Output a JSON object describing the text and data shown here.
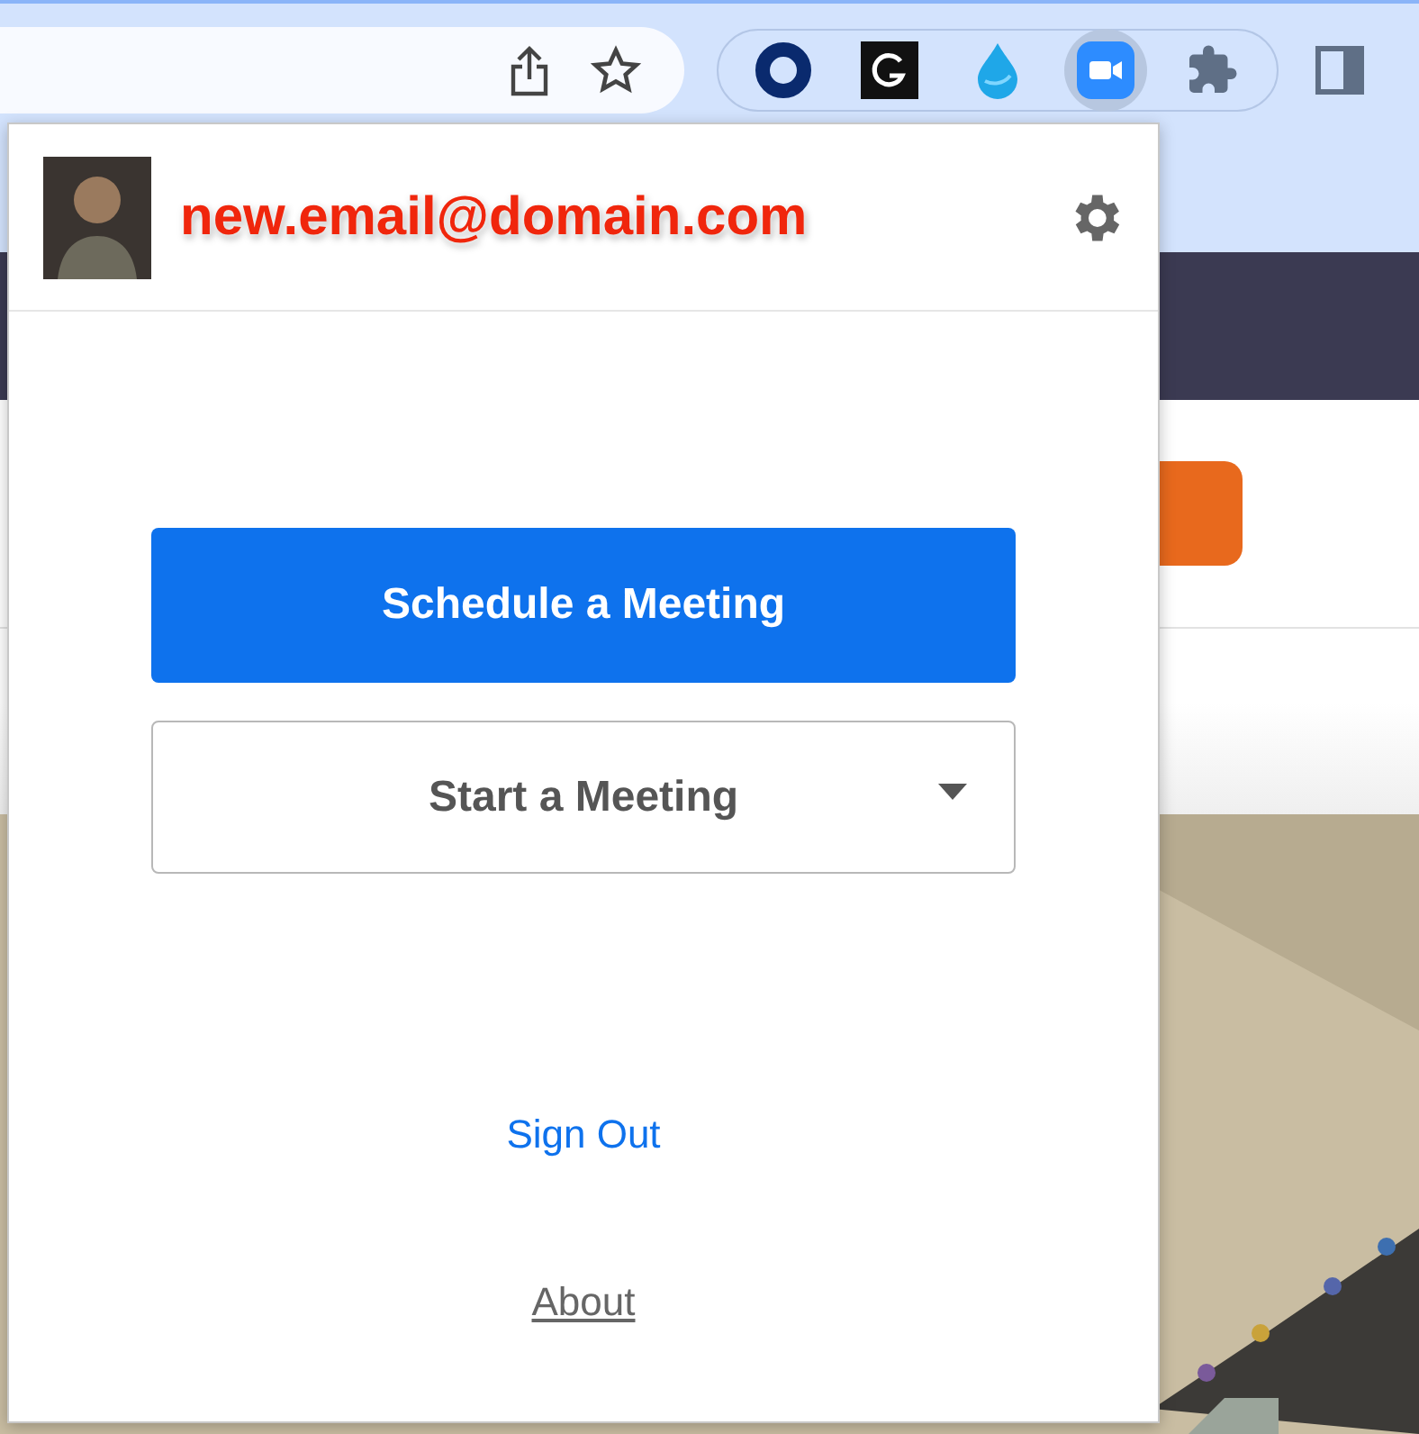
{
  "toolbar": {
    "extensions": [
      {
        "kind": "ring",
        "active": false
      },
      {
        "kind": "g-square",
        "active": false
      },
      {
        "kind": "drop",
        "active": false
      },
      {
        "kind": "camera",
        "active": true
      },
      {
        "kind": "puzzle",
        "active": false
      }
    ]
  },
  "popup": {
    "account": {
      "email": "new.email@domain.com"
    },
    "primary_button": "Schedule a Meeting",
    "start_menu": {
      "label": "Start a Meeting"
    },
    "links": [
      {
        "label": "Sign Out",
        "kind": "action"
      },
      {
        "label": "About",
        "kind": "underlined"
      }
    ]
  }
}
